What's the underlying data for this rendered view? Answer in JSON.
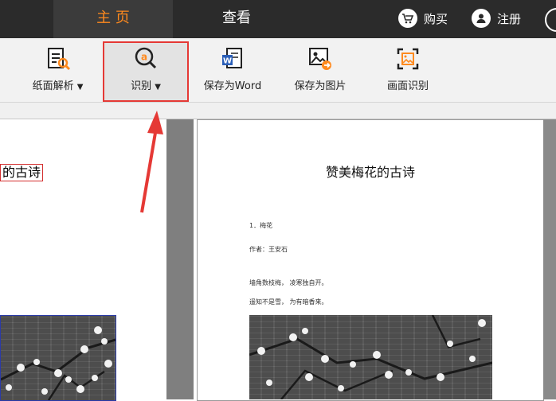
{
  "top_tabs": [
    "主 页",
    "查看"
  ],
  "top_buttons": {
    "buy": "购买",
    "register": "注册"
  },
  "toolbar": {
    "items": [
      "纸面解析",
      "识别",
      "保存为Word",
      "保存为图片",
      "画面识别"
    ],
    "dropdown_glyph": "▼"
  },
  "left_pane": {
    "highlighted_text": "的古诗"
  },
  "document": {
    "title": "赞美梅花的古诗",
    "lines": [
      "1．梅花",
      "作者：王安石",
      "墙角数枝梅，  凌寒独自开。",
      "遥知不是雪，  为有暗香来。"
    ]
  },
  "colors": {
    "accent": "#ff8a1e",
    "highlight_border": "#e53935",
    "topbar": "#2b2b2b"
  }
}
